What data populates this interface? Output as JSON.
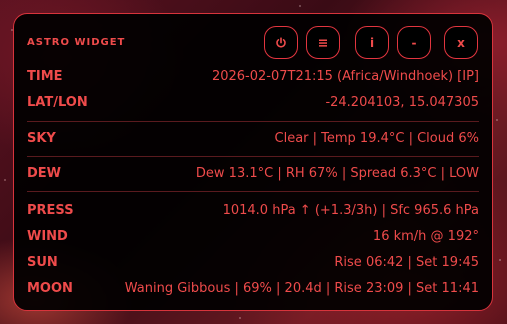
{
  "widget": {
    "title": "ASTRO WIDGET",
    "buttons": {
      "power_icon": "power-icon",
      "menu_icon": "menu-icon",
      "info_label": "i",
      "minimize_label": "-",
      "close_label": "x"
    }
  },
  "rows": {
    "time": {
      "label": "TIME",
      "value": "2026-02-07T21:15 (Africa/Windhoek) [IP]"
    },
    "latlon": {
      "label": "LAT/LON",
      "value": "-24.204103, 15.047305"
    },
    "sky": {
      "label": "SKY",
      "value": "Clear | Temp 19.4°C | Cloud 6%"
    },
    "dew": {
      "label": "DEW",
      "value": "Dew 13.1°C | RH 67% | Spread 6.3°C | LOW"
    },
    "press": {
      "label": "PRESS",
      "value": "1014.0 hPa ↑ (+1.3/3h) | Sfc 965.6 hPa"
    },
    "wind": {
      "label": "WIND",
      "value": "16 km/h @ 192°"
    },
    "sun": {
      "label": "SUN",
      "value": "Rise 06:42 | Set 19:45"
    },
    "moon": {
      "label": "MOON",
      "value": "Waning Gibbous | 69% | 20.4d | Rise 23:09 | Set 11:41"
    }
  },
  "colors": {
    "accent": "#ef4b4b",
    "border": "#d8343c",
    "panel_background": "#000000",
    "divider": "#5a1a1e"
  }
}
